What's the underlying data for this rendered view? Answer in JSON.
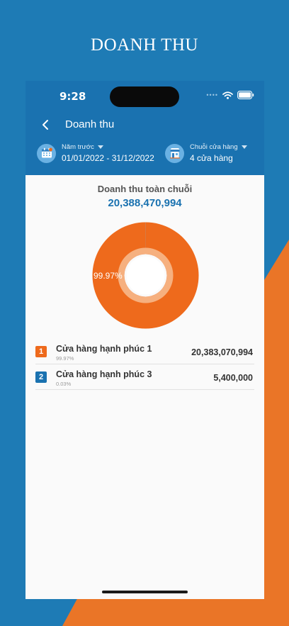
{
  "promo_title": "DOANH THU",
  "status": {
    "time": "9:28"
  },
  "nav": {
    "title": "Doanh thu"
  },
  "filters": {
    "date": {
      "label": "Năm trước",
      "value": "01/01/2022 - 31/12/2022"
    },
    "store": {
      "label": "Chuỗi cửa hàng",
      "value": "4 cửa hàng"
    }
  },
  "summary": {
    "title": "Doanh thu toàn chuỗi",
    "total": "20,388,470,994"
  },
  "chart_data": {
    "type": "pie",
    "slices": [
      {
        "label": "Cửa hàng hạnh phúc 1",
        "value": 99.97,
        "color": "#ee6a1c"
      },
      {
        "label": "Cửa hàng hạnh phúc 3",
        "value": 0.03,
        "color": "#1a72b0"
      }
    ],
    "slice_label": "99.97%"
  },
  "stores": [
    {
      "rank": "1",
      "name": "Cửa hàng hạnh phúc 1",
      "percent": "99.97%",
      "value": "20,383,070,994",
      "color": "#ee6a1c"
    },
    {
      "rank": "2",
      "name": "Cửa hàng hạnh phúc 3",
      "percent": "0.03%",
      "value": "5,400,000",
      "color": "#1a72b0"
    }
  ],
  "colors": {
    "brand_blue": "#1a72b0",
    "background_blue": "#1e7bb5",
    "accent_orange": "#ee6a1c"
  },
  "icons": {
    "back": "chevron-left-icon",
    "calendar": "calendar-icon",
    "store": "store-icon",
    "wifi": "wifi-icon",
    "battery": "battery-icon"
  }
}
